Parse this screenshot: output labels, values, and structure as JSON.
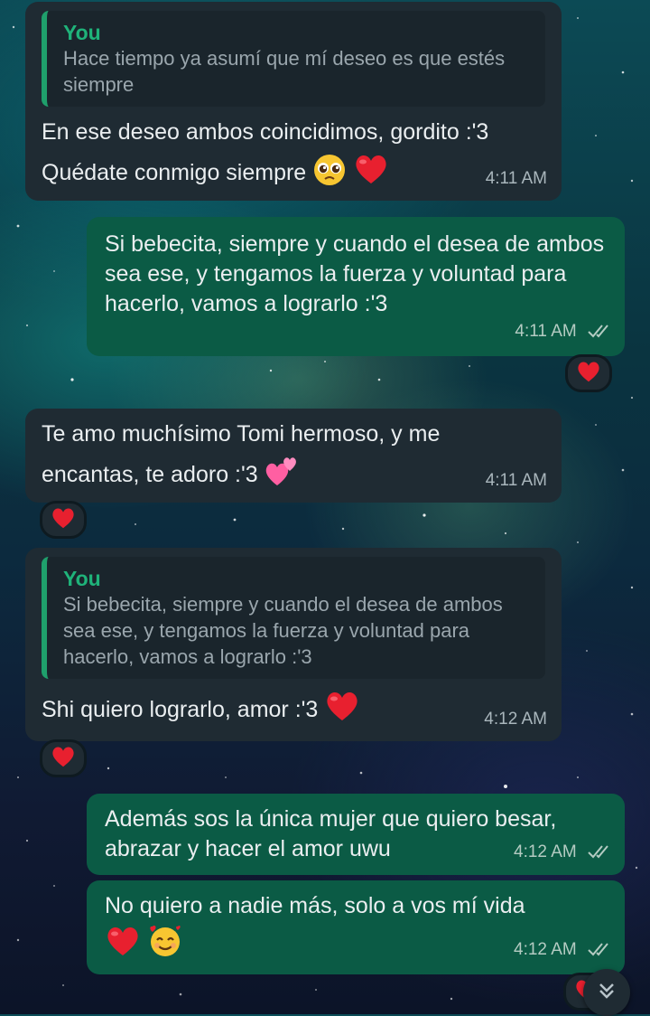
{
  "messages": [
    {
      "quote_name": "You",
      "quote_text": "Hace tiempo ya asumí que mí deseo es que estés siempre",
      "line1": "En ese deseo ambos coincidimos, gordito :'3",
      "line2": "Quédate conmigo siempre",
      "time": "4:11 AM"
    },
    {
      "text": "Si bebecita, siempre y cuando el desea de ambos sea ese, y tengamos la fuerza y voluntad para hacerlo, vamos a lograrlo :'3",
      "time": "4:11 AM"
    },
    {
      "line1": "Te amo muchísimo Tomi hermoso, y me",
      "line2": "encantas, te adoro :'3",
      "time": "4:11 AM"
    },
    {
      "quote_name": "You",
      "quote_text": "Si bebecita, siempre y cuando el desea de ambos sea ese, y tengamos la fuerza y voluntad para hacerlo, vamos a lograrlo :'3",
      "text": "Shi quiero lograrlo, amor :'3",
      "time": "4:12 AM"
    },
    {
      "text": "Además sos la única mujer que quiero besar, abrazar y hacer el amor uwu",
      "time": "4:12 AM"
    },
    {
      "text": "No quiero a nadie más, solo a vos mí vida",
      "time": "4:12 AM"
    }
  ],
  "colors": {
    "incoming": "#1f2b33",
    "outgoing": "#0b5b45",
    "quote_accent": "#1fa06c",
    "heart": "#e8202f"
  },
  "icons": [
    "heart-emoji",
    "pleading-face-emoji",
    "two-hearts-emoji",
    "smiling-face-with-hearts-emoji",
    "double-check-icon",
    "chevron-double-down-icon"
  ]
}
